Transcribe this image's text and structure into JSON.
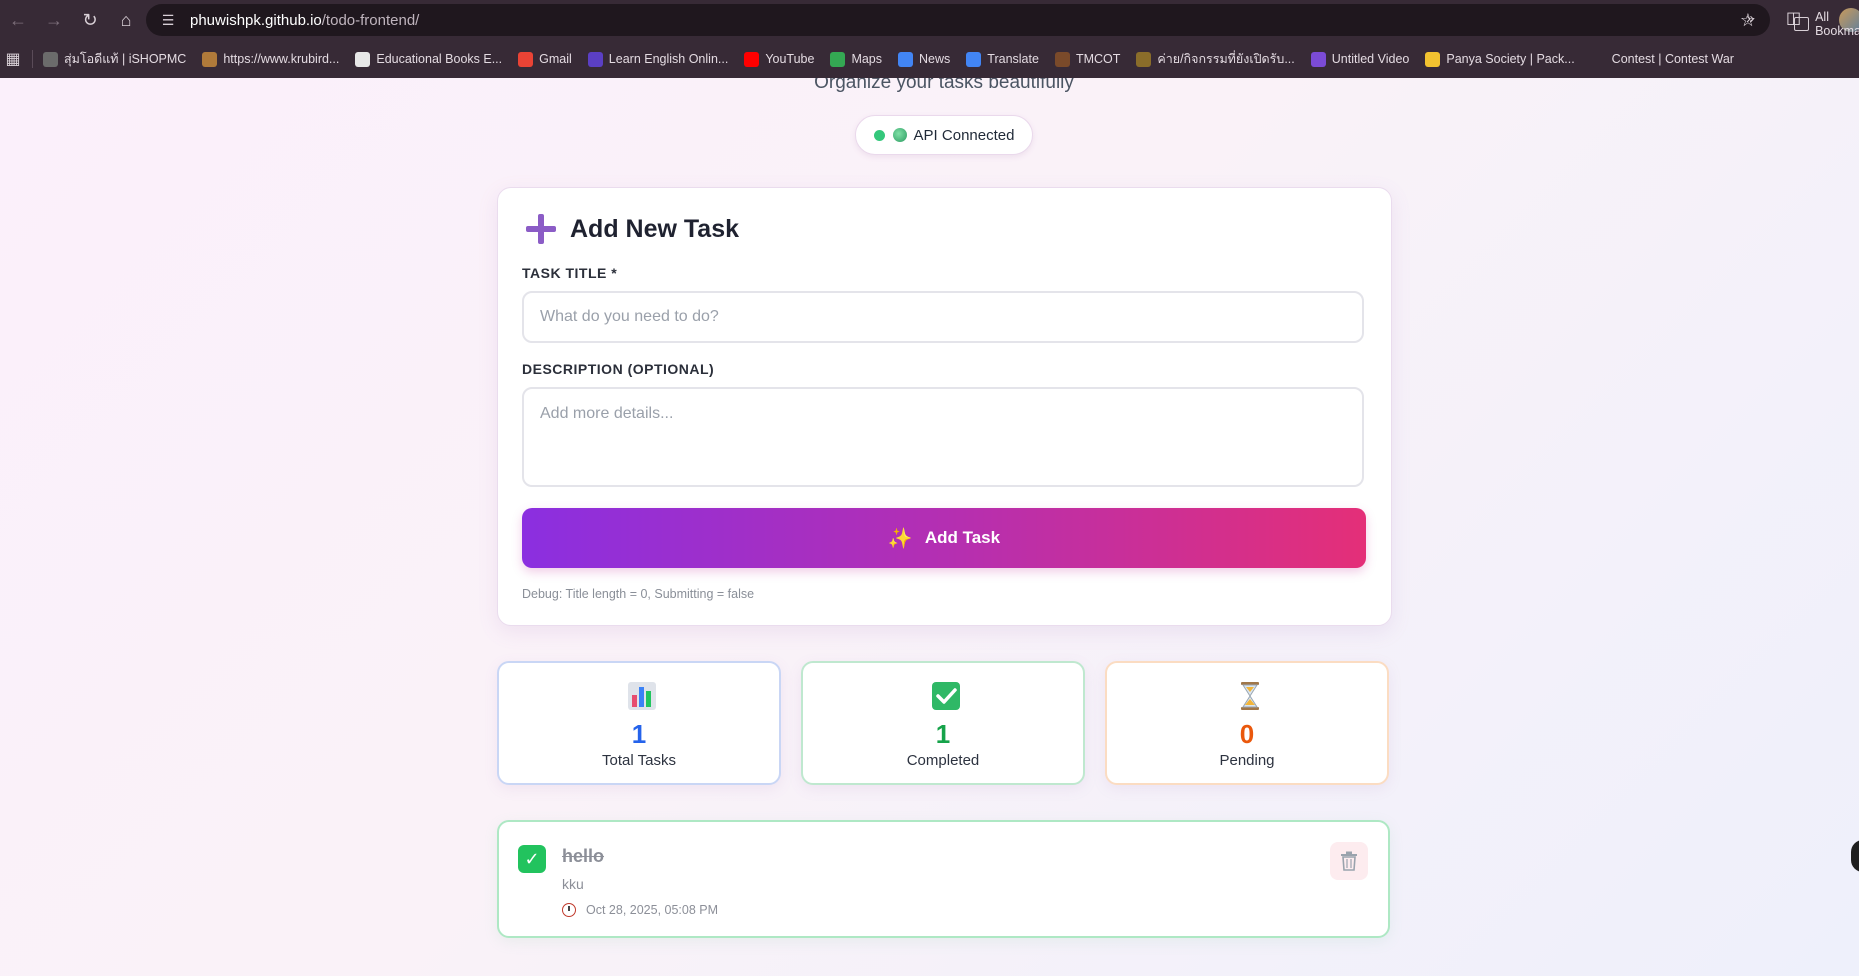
{
  "browser": {
    "url_host": "phuwishpk.github.io",
    "url_path": "/todo-frontend/",
    "bookmarks": [
      {
        "label": "สุ่มโอดีแท้ | iSHOPMC",
        "color": "#6b6b6b"
      },
      {
        "label": "https://www.krubird...",
        "color": "#b07a3a"
      },
      {
        "label": "Educational Books E...",
        "color": "#e7e7e7"
      },
      {
        "label": "Gmail",
        "color": "#ea4335"
      },
      {
        "label": "Learn English Onlin...",
        "color": "#5b3fc4"
      },
      {
        "label": "YouTube",
        "color": "#ff0000"
      },
      {
        "label": "Maps",
        "color": "#34a853"
      },
      {
        "label": "News",
        "color": "#4285f4"
      },
      {
        "label": "Translate",
        "color": "#4285f4"
      },
      {
        "label": "TMCOT",
        "color": "#7a4a2a"
      },
      {
        "label": "ค่าย/กิจกรรมที่ยังเปิดรับ...",
        "color": "#8a6d2a"
      },
      {
        "label": "Untitled Video",
        "color": "#7b4bd6"
      },
      {
        "label": "Panya Society | Pack...",
        "color": "#f2c230"
      },
      {
        "label": "Contest | Contest War",
        "color": "#372a36"
      }
    ],
    "all_bookmarks_label": "All Bookmarks"
  },
  "header": {
    "subtitle": "Organize your tasks beautifully",
    "api_status": "API Connected"
  },
  "form": {
    "heading": "Add New Task",
    "title_label": "TASK TITLE *",
    "title_placeholder": "What do you need to do?",
    "title_value": "",
    "description_label": "DESCRIPTION (OPTIONAL)",
    "description_placeholder": "Add more details...",
    "description_value": "",
    "submit_label": "Add Task",
    "debug": "Debug: Title length = 0, Submitting = false"
  },
  "stats": {
    "total": {
      "value": "1",
      "label": "Total Tasks",
      "color": "#2563eb"
    },
    "completed": {
      "value": "1",
      "label": "Completed",
      "color": "#16a34a"
    },
    "pending": {
      "value": "0",
      "label": "Pending",
      "color": "#ea580c"
    }
  },
  "tasks": [
    {
      "title": "hello",
      "description": "kku",
      "date": "Oct 28, 2025, 05:08 PM",
      "completed": true
    }
  ],
  "colors": {
    "accent_gradient_start": "#8b2fe0",
    "accent_gradient_end": "#e42f78",
    "success": "#22c35e"
  }
}
